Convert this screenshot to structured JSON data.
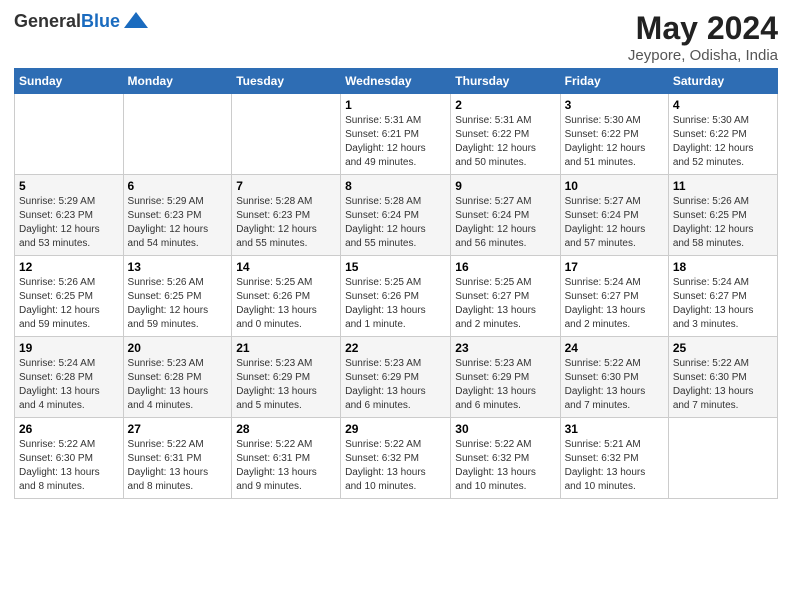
{
  "header": {
    "logo_general": "General",
    "logo_blue": "Blue",
    "month": "May 2024",
    "location": "Jeypore, Odisha, India"
  },
  "weekdays": [
    "Sunday",
    "Monday",
    "Tuesday",
    "Wednesday",
    "Thursday",
    "Friday",
    "Saturday"
  ],
  "weeks": [
    [
      {
        "day": "",
        "info": ""
      },
      {
        "day": "",
        "info": ""
      },
      {
        "day": "",
        "info": ""
      },
      {
        "day": "1",
        "info": "Sunrise: 5:31 AM\nSunset: 6:21 PM\nDaylight: 12 hours\nand 49 minutes."
      },
      {
        "day": "2",
        "info": "Sunrise: 5:31 AM\nSunset: 6:22 PM\nDaylight: 12 hours\nand 50 minutes."
      },
      {
        "day": "3",
        "info": "Sunrise: 5:30 AM\nSunset: 6:22 PM\nDaylight: 12 hours\nand 51 minutes."
      },
      {
        "day": "4",
        "info": "Sunrise: 5:30 AM\nSunset: 6:22 PM\nDaylight: 12 hours\nand 52 minutes."
      }
    ],
    [
      {
        "day": "5",
        "info": "Sunrise: 5:29 AM\nSunset: 6:23 PM\nDaylight: 12 hours\nand 53 minutes."
      },
      {
        "day": "6",
        "info": "Sunrise: 5:29 AM\nSunset: 6:23 PM\nDaylight: 12 hours\nand 54 minutes."
      },
      {
        "day": "7",
        "info": "Sunrise: 5:28 AM\nSunset: 6:23 PM\nDaylight: 12 hours\nand 55 minutes."
      },
      {
        "day": "8",
        "info": "Sunrise: 5:28 AM\nSunset: 6:24 PM\nDaylight: 12 hours\nand 55 minutes."
      },
      {
        "day": "9",
        "info": "Sunrise: 5:27 AM\nSunset: 6:24 PM\nDaylight: 12 hours\nand 56 minutes."
      },
      {
        "day": "10",
        "info": "Sunrise: 5:27 AM\nSunset: 6:24 PM\nDaylight: 12 hours\nand 57 minutes."
      },
      {
        "day": "11",
        "info": "Sunrise: 5:26 AM\nSunset: 6:25 PM\nDaylight: 12 hours\nand 58 minutes."
      }
    ],
    [
      {
        "day": "12",
        "info": "Sunrise: 5:26 AM\nSunset: 6:25 PM\nDaylight: 12 hours\nand 59 minutes."
      },
      {
        "day": "13",
        "info": "Sunrise: 5:26 AM\nSunset: 6:25 PM\nDaylight: 12 hours\nand 59 minutes."
      },
      {
        "day": "14",
        "info": "Sunrise: 5:25 AM\nSunset: 6:26 PM\nDaylight: 13 hours\nand 0 minutes."
      },
      {
        "day": "15",
        "info": "Sunrise: 5:25 AM\nSunset: 6:26 PM\nDaylight: 13 hours\nand 1 minute."
      },
      {
        "day": "16",
        "info": "Sunrise: 5:25 AM\nSunset: 6:27 PM\nDaylight: 13 hours\nand 2 minutes."
      },
      {
        "day": "17",
        "info": "Sunrise: 5:24 AM\nSunset: 6:27 PM\nDaylight: 13 hours\nand 2 minutes."
      },
      {
        "day": "18",
        "info": "Sunrise: 5:24 AM\nSunset: 6:27 PM\nDaylight: 13 hours\nand 3 minutes."
      }
    ],
    [
      {
        "day": "19",
        "info": "Sunrise: 5:24 AM\nSunset: 6:28 PM\nDaylight: 13 hours\nand 4 minutes."
      },
      {
        "day": "20",
        "info": "Sunrise: 5:23 AM\nSunset: 6:28 PM\nDaylight: 13 hours\nand 4 minutes."
      },
      {
        "day": "21",
        "info": "Sunrise: 5:23 AM\nSunset: 6:29 PM\nDaylight: 13 hours\nand 5 minutes."
      },
      {
        "day": "22",
        "info": "Sunrise: 5:23 AM\nSunset: 6:29 PM\nDaylight: 13 hours\nand 6 minutes."
      },
      {
        "day": "23",
        "info": "Sunrise: 5:23 AM\nSunset: 6:29 PM\nDaylight: 13 hours\nand 6 minutes."
      },
      {
        "day": "24",
        "info": "Sunrise: 5:22 AM\nSunset: 6:30 PM\nDaylight: 13 hours\nand 7 minutes."
      },
      {
        "day": "25",
        "info": "Sunrise: 5:22 AM\nSunset: 6:30 PM\nDaylight: 13 hours\nand 7 minutes."
      }
    ],
    [
      {
        "day": "26",
        "info": "Sunrise: 5:22 AM\nSunset: 6:30 PM\nDaylight: 13 hours\nand 8 minutes."
      },
      {
        "day": "27",
        "info": "Sunrise: 5:22 AM\nSunset: 6:31 PM\nDaylight: 13 hours\nand 8 minutes."
      },
      {
        "day": "28",
        "info": "Sunrise: 5:22 AM\nSunset: 6:31 PM\nDaylight: 13 hours\nand 9 minutes."
      },
      {
        "day": "29",
        "info": "Sunrise: 5:22 AM\nSunset: 6:32 PM\nDaylight: 13 hours\nand 10 minutes."
      },
      {
        "day": "30",
        "info": "Sunrise: 5:22 AM\nSunset: 6:32 PM\nDaylight: 13 hours\nand 10 minutes."
      },
      {
        "day": "31",
        "info": "Sunrise: 5:21 AM\nSunset: 6:32 PM\nDaylight: 13 hours\nand 10 minutes."
      },
      {
        "day": "",
        "info": ""
      }
    ]
  ]
}
